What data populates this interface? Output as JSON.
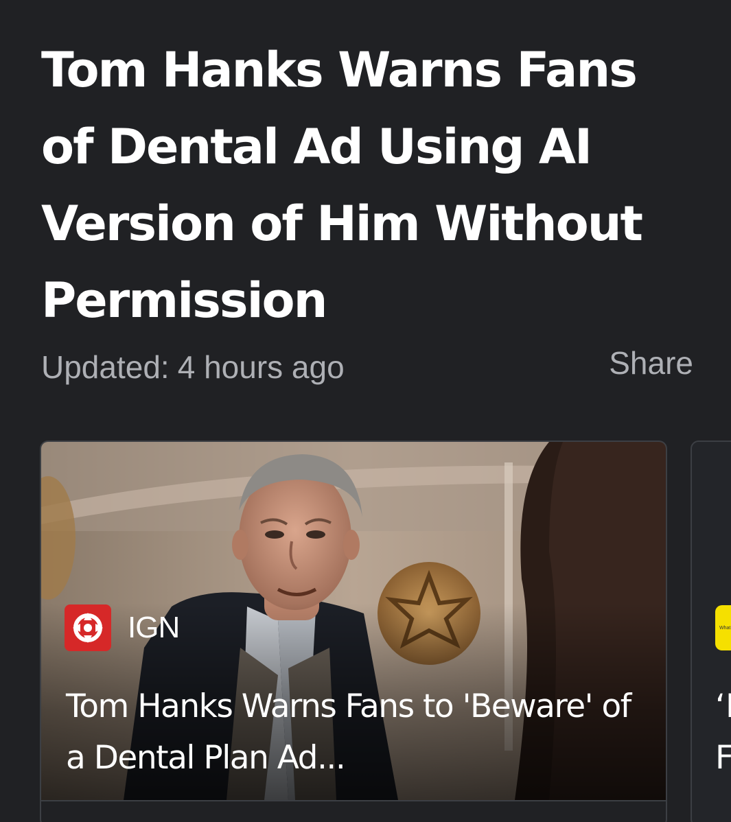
{
  "article": {
    "headline": "Tom Hanks Warns Fans of Dental Ad Using AI Version of Him Without Permission",
    "updated_label": "Updated:",
    "updated_value": "4 hours ago",
    "share_label": "Share"
  },
  "cards": [
    {
      "source": "IGN",
      "source_icon": "ign-logo-icon",
      "title": "Tom Hanks Warns Fans to 'Beware' of a Dental Plan Ad...",
      "image": "movie-still-photo"
    },
    {
      "source_badge_text": "What",
      "title_fragment": "‘I\nF"
    }
  ],
  "colors": {
    "background": "#202124",
    "headline": "#ffffff",
    "meta": "#aeb0b5",
    "card_border": "#3c3f44",
    "ign_red": "#d62828",
    "badge_yellow": "#f5e000"
  }
}
